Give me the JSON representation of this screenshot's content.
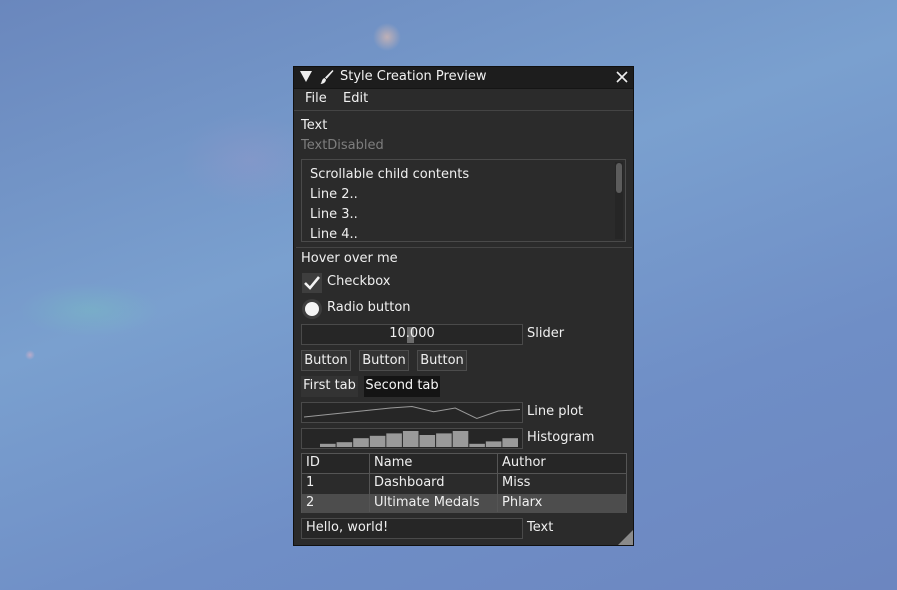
{
  "window": {
    "title": "Style Creation Preview",
    "icons": {
      "collapse": "collapse-triangle-icon",
      "brush": "paintbrush-icon",
      "close": "close-icon"
    }
  },
  "menu": {
    "file": "File",
    "edit": "Edit"
  },
  "text": {
    "normal": "Text",
    "disabled": "TextDisabled"
  },
  "child": {
    "lines": [
      "Scrollable child contents",
      "Line 2..",
      "Line 3..",
      "Line 4.."
    ]
  },
  "hover": "Hover over me",
  "checkbox": {
    "label": "Checkbox",
    "checked": true
  },
  "radio": {
    "label": "Radio button",
    "selected": true
  },
  "slider": {
    "value": "10.000",
    "label": "Slider"
  },
  "buttons": [
    "Button",
    "Button",
    "Button"
  ],
  "tabs": [
    "First tab",
    "Second tab"
  ],
  "lineplot": {
    "label": "Line plot",
    "values": [
      0.2,
      0.35,
      0.5,
      0.65,
      0.8,
      0.9,
      0.55,
      0.8,
      0.1,
      0.6,
      0.7
    ]
  },
  "histogram": {
    "label": "Histogram",
    "values": [
      0.2,
      0.3,
      0.55,
      0.7,
      0.85,
      1.0,
      0.75,
      0.85,
      1.0,
      0.2,
      0.35,
      0.55
    ]
  },
  "table": {
    "headers": [
      "ID",
      "Name",
      "Author"
    ],
    "rows": [
      [
        "1",
        "Dashboard",
        "Miss"
      ],
      [
        "2",
        "Ultimate Medals",
        "Phlarx"
      ]
    ]
  },
  "input": {
    "value": "Hello, world!",
    "label": "Text"
  },
  "colors": {
    "window_bg": "#2b2b2b",
    "title_bg": "#1d1d1d",
    "frame_bg": "#262626",
    "selected_row": "#4d4d4d",
    "plot": "#9a9a9a"
  }
}
